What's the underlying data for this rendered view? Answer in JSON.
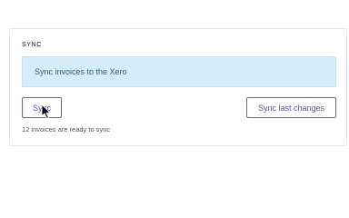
{
  "sync": {
    "section_title": "SYNC",
    "banner_text": "Sync invoices to the Xero",
    "sync_button_label": "Sync",
    "sync_last_button_label": "Sync last changes",
    "status_text": "12 invoices are ready to sync"
  },
  "colors": {
    "accent": "#6b5fb5",
    "banner_bg": "#d5ecf9",
    "banner_text": "#2d5f7e"
  },
  "icons": {
    "cursor": "mouse-pointer-icon"
  }
}
